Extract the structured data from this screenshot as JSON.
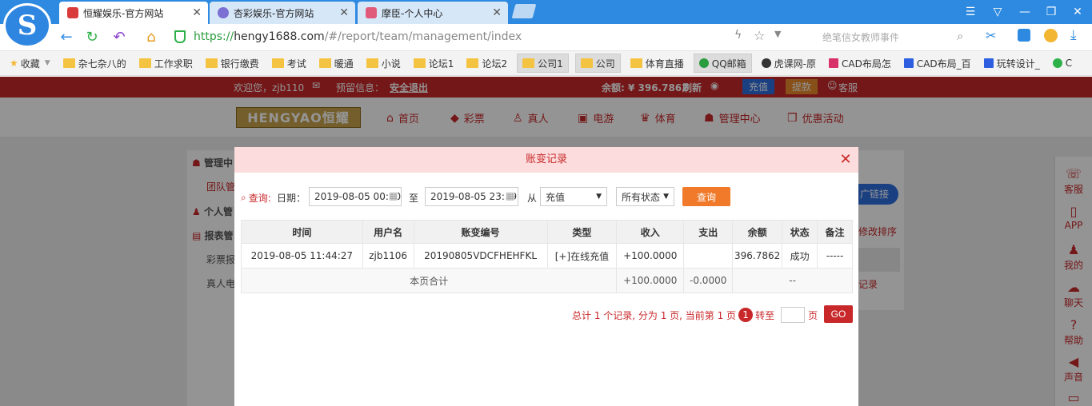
{
  "browser": {
    "tabs": [
      {
        "title": "恒耀娱乐-官方网站",
        "active": true
      },
      {
        "title": "杏彩娱乐-官方网站",
        "active": false
      },
      {
        "title": "摩臣-个人中心",
        "active": false
      }
    ],
    "url_scheme": "https://",
    "url_host": "hengy1688.com",
    "url_path": "/#/report/team/management/index",
    "search_placeholder": "绝笔信女教师事件",
    "bookmarks": [
      "收藏",
      "杂七杂八的",
      "工作求职",
      "银行缴费",
      "考试",
      "暖通",
      "小说",
      "论坛1",
      "论坛2",
      "公司1",
      "公司",
      "体育直播",
      "QQ邮箱",
      "虎课网-原",
      "CAD布局怎",
      "CAD布局_百",
      "玩转设计_",
      "C"
    ]
  },
  "site": {
    "welcome": "欢迎您，zjb110",
    "warning_label": "预留信息：",
    "logout": "安全退出",
    "balance_label": "余额: ¥ 396.7862",
    "refresh": "刷新",
    "recharge": "充值",
    "withdraw": "提款",
    "service": "客服",
    "logo_text": "HENGYAO恒耀",
    "nav": [
      "首页",
      "彩票",
      "真人",
      "电游",
      "体育",
      "管理中心",
      "优惠活动"
    ],
    "side_menu": [
      "管理中",
      "团队管",
      "个人管",
      "报表管",
      "彩票报",
      "真人电"
    ],
    "right_texts": [
      "广链接",
      "修改排序",
      "记录"
    ],
    "float_bar": [
      "客服",
      "APP",
      "我的",
      "聊天",
      "帮助",
      "声音"
    ]
  },
  "modal": {
    "title": "账变记录",
    "query_label": "查询:",
    "date_label": "日期：",
    "date_from": "2019-08-05 00:00",
    "to_label": "至",
    "date_to": "2019-08-05 23:59",
    "from_label": "从",
    "type_selected": "充值",
    "status_selected": "所有状态",
    "query_button": "查询",
    "columns": [
      "时间",
      "用户名",
      "账变编号",
      "类型",
      "收入",
      "支出",
      "余额",
      "状态",
      "备注"
    ],
    "rows": [
      {
        "time": "2019-08-05 11:44:27",
        "user": "zjb1106",
        "id": "20190805VDCFHEHFKL",
        "type": "[+]在线充值",
        "income": "+100.0000",
        "expense": "",
        "balance": "396.7862",
        "status": "成功",
        "remark": "-----"
      }
    ],
    "summary": {
      "label": "本页合计",
      "income": "+100.0000",
      "expense": "-0.0000",
      "balance": "--"
    },
    "pager": {
      "text": "总计 1 个记录, 分为 1 页, 当前第 1 页",
      "current": "1",
      "goto": "转至",
      "page_unit": "页",
      "go": "GO"
    }
  }
}
